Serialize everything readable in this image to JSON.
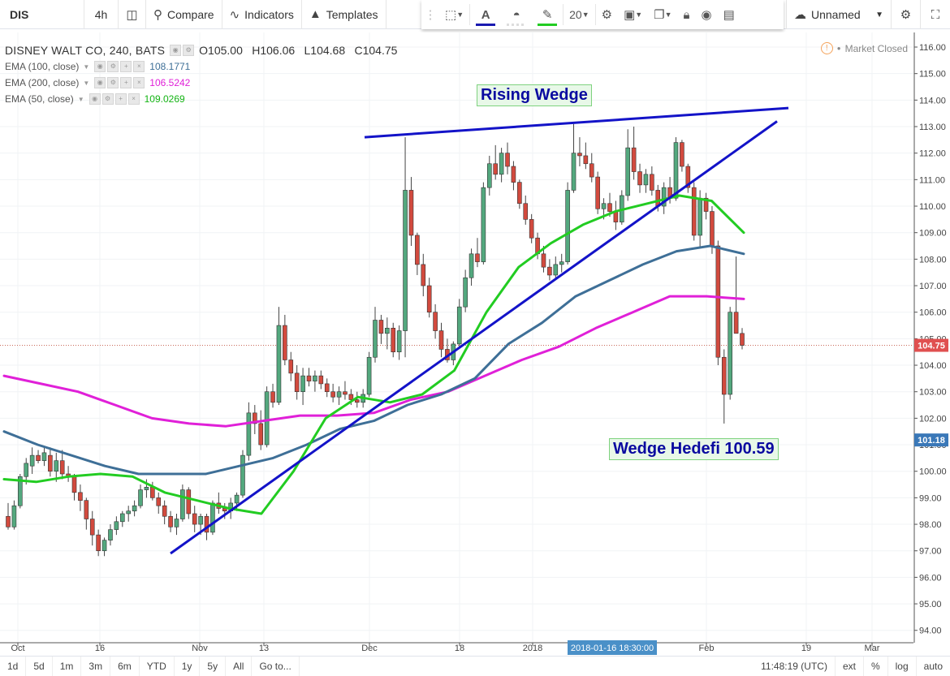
{
  "toolbar": {
    "symbol": "DIS",
    "interval": "4h",
    "compare_label": "Compare",
    "indicators_label": "Indicators",
    "templates_label": "Templates",
    "font_size": "20",
    "layout_name": "Unnamed",
    "icons": [
      "candles-icon",
      "compare-icon",
      "indicators-icon",
      "templates-icon",
      "selection-icon",
      "text-color-icon",
      "fill-icon",
      "pencil-icon",
      "gear-icon",
      "layers-icon",
      "clone-icon",
      "lock-icon",
      "eye-icon",
      "trash-icon",
      "cloud-icon",
      "settings-icon",
      "fullscreen-icon"
    ],
    "accent_text_color": "#1a1ab0",
    "accent_pen_color": "#22cc22"
  },
  "legend": {
    "title": "DISNEY WALT CO, 240, BATS",
    "ohlc": {
      "o": "O105.00",
      "h": "H106.06",
      "l": "L104.68",
      "c": "C104.75"
    },
    "indicators": [
      {
        "name": "EMA (100, close)",
        "value": "108.1771",
        "color": "#3e6f97"
      },
      {
        "name": "EMA (200, close)",
        "value": "106.5242",
        "color": "#e020d8"
      },
      {
        "name": "EMA (50, close)",
        "value": "109.0269",
        "color": "#22cc22"
      }
    ]
  },
  "market_status": "Market Closed",
  "annotations": {
    "rising_wedge": "Rising Wedge",
    "wedge_target": "Wedge Hedefi 100.59"
  },
  "price_axis": {
    "ticks": [
      "116.00",
      "115.00",
      "114.00",
      "113.00",
      "112.00",
      "111.00",
      "110.00",
      "109.00",
      "108.00",
      "107.00",
      "106.00",
      "105.00",
      "104.00",
      "103.00",
      "102.00",
      "101.00",
      "100.00",
      "99.00",
      "98.00",
      "97.00",
      "96.00",
      "95.00",
      "94.00"
    ],
    "last_price": "104.75",
    "last_price_color": "#e05050",
    "target_label": "101.18",
    "target_color": "#3a78b8"
  },
  "time_axis": {
    "ticks": [
      "Oct",
      "16",
      "Nov",
      "13",
      "Dec",
      "18",
      "2018",
      "Feb",
      "19",
      "Mar"
    ],
    "crosshair_label": "2018-01-16 18:30:00"
  },
  "bottom_bar": {
    "ranges": [
      "1d",
      "5d",
      "1m",
      "3m",
      "6m",
      "YTD",
      "1y",
      "5y",
      "All"
    ],
    "goto": "Go to...",
    "time": "11:48:19 (UTC)",
    "options": [
      "ext",
      "%",
      "log",
      "auto"
    ]
  },
  "chart_data": {
    "type": "candlestick",
    "symbol": "DISNEY WALT CO",
    "interval": "240",
    "ylim": [
      93.6,
      116.4
    ],
    "up_color": "#53a87e",
    "down_color": "#d24a3e",
    "candles": [
      [
        98.3,
        98.8,
        97.8,
        97.9
      ],
      [
        97.9,
        98.9,
        97.8,
        98.7
      ],
      [
        98.7,
        99.9,
        98.6,
        99.8
      ],
      [
        99.8,
        100.5,
        99.5,
        100.3
      ],
      [
        100.2,
        100.9,
        99.9,
        100.6
      ],
      [
        100.6,
        100.8,
        100.3,
        100.4
      ],
      [
        100.4,
        100.9,
        100.2,
        100.7
      ],
      [
        100.6,
        100.9,
        99.8,
        100.0
      ],
      [
        100.0,
        100.7,
        99.6,
        100.4
      ],
      [
        100.4,
        100.8,
        99.7,
        99.9
      ],
      [
        99.9,
        100.2,
        99.6,
        99.8
      ],
      [
        99.8,
        99.9,
        98.9,
        99.2
      ],
      [
        99.2,
        99.5,
        98.5,
        98.9
      ],
      [
        98.9,
        99.0,
        97.8,
        98.2
      ],
      [
        98.2,
        98.5,
        97.2,
        97.6
      ],
      [
        97.6,
        97.8,
        96.8,
        97.0
      ],
      [
        97.0,
        97.5,
        96.8,
        97.4
      ],
      [
        97.4,
        98.0,
        97.2,
        97.8
      ],
      [
        97.8,
        98.3,
        97.6,
        98.1
      ],
      [
        98.1,
        98.5,
        97.9,
        98.4
      ],
      [
        98.4,
        98.7,
        98.1,
        98.5
      ],
      [
        98.5,
        98.9,
        98.3,
        98.7
      ],
      [
        98.7,
        99.5,
        98.6,
        99.3
      ],
      [
        99.3,
        99.7,
        99.0,
        99.4
      ],
      [
        99.4,
        99.6,
        98.9,
        99.0
      ],
      [
        99.0,
        99.2,
        98.4,
        98.7
      ],
      [
        98.7,
        98.9,
        98.0,
        98.3
      ],
      [
        98.3,
        98.5,
        97.7,
        97.9
      ],
      [
        97.9,
        98.4,
        97.6,
        98.2
      ],
      [
        98.2,
        99.5,
        98.1,
        99.3
      ],
      [
        99.3,
        99.4,
        98.2,
        98.4
      ],
      [
        98.4,
        98.7,
        97.7,
        98.0
      ],
      [
        98.0,
        98.4,
        97.6,
        98.3
      ],
      [
        98.3,
        98.4,
        97.4,
        97.7
      ],
      [
        97.7,
        98.9,
        97.6,
        98.8
      ],
      [
        98.8,
        99.2,
        98.4,
        98.6
      ],
      [
        98.6,
        98.8,
        98.2,
        98.5
      ],
      [
        98.5,
        99.0,
        98.2,
        98.8
      ],
      [
        98.8,
        99.2,
        98.5,
        99.1
      ],
      [
        99.1,
        100.8,
        99.0,
        100.6
      ],
      [
        100.6,
        102.6,
        100.4,
        102.2
      ],
      [
        102.2,
        102.5,
        101.4,
        101.8
      ],
      [
        101.8,
        102.3,
        100.8,
        101.0
      ],
      [
        101.0,
        103.2,
        100.9,
        103.0
      ],
      [
        103.0,
        103.3,
        102.4,
        102.6
      ],
      [
        102.6,
        106.2,
        102.5,
        105.5
      ],
      [
        105.5,
        105.9,
        104.0,
        104.2
      ],
      [
        104.2,
        104.5,
        103.4,
        103.7
      ],
      [
        103.7,
        104.0,
        102.7,
        103.0
      ],
      [
        103.0,
        103.9,
        102.5,
        103.6
      ],
      [
        103.6,
        103.9,
        103.2,
        103.4
      ],
      [
        103.4,
        103.8,
        103.0,
        103.6
      ],
      [
        103.6,
        103.8,
        103.1,
        103.3
      ],
      [
        103.3,
        103.5,
        102.8,
        103.0
      ],
      [
        103.0,
        103.3,
        102.6,
        102.8
      ],
      [
        102.8,
        103.2,
        102.5,
        103.0
      ],
      [
        103.0,
        103.4,
        102.7,
        102.9
      ],
      [
        102.9,
        103.1,
        102.5,
        102.7
      ],
      [
        102.7,
        103.0,
        102.4,
        102.6
      ],
      [
        102.6,
        103.1,
        102.4,
        102.9
      ],
      [
        102.9,
        104.5,
        102.8,
        104.3
      ],
      [
        104.3,
        106.2,
        104.1,
        105.7
      ],
      [
        105.7,
        105.9,
        104.8,
        105.2
      ],
      [
        105.2,
        105.8,
        104.6,
        105.4
      ],
      [
        105.4,
        105.6,
        104.3,
        104.5
      ],
      [
        104.5,
        105.5,
        104.2,
        105.3
      ],
      [
        105.3,
        112.6,
        104.3,
        110.6
      ],
      [
        110.6,
        111.1,
        108.5,
        108.9
      ],
      [
        108.9,
        109.0,
        107.4,
        107.8
      ],
      [
        107.8,
        108.2,
        106.6,
        107.0
      ],
      [
        107.0,
        107.3,
        105.8,
        106.0
      ],
      [
        106.0,
        106.3,
        105.0,
        105.3
      ],
      [
        105.3,
        105.6,
        104.3,
        104.6
      ],
      [
        104.6,
        105.0,
        104.1,
        104.2
      ],
      [
        104.2,
        104.9,
        104.0,
        104.8
      ],
      [
        104.8,
        106.5,
        104.7,
        106.2
      ],
      [
        106.2,
        107.6,
        106.0,
        107.3
      ],
      [
        107.3,
        108.4,
        107.0,
        108.2
      ],
      [
        108.2,
        108.8,
        107.7,
        107.9
      ],
      [
        107.9,
        110.9,
        107.8,
        110.7
      ],
      [
        110.7,
        111.9,
        110.4,
        111.6
      ],
      [
        111.6,
        112.3,
        111.0,
        111.2
      ],
      [
        111.2,
        112.2,
        110.9,
        112.0
      ],
      [
        112.0,
        112.4,
        111.2,
        111.5
      ],
      [
        111.5,
        111.7,
        110.6,
        110.9
      ],
      [
        110.9,
        111.0,
        109.9,
        110.1
      ],
      [
        110.1,
        110.4,
        109.3,
        109.5
      ],
      [
        109.5,
        109.7,
        108.6,
        108.8
      ],
      [
        108.8,
        109.0,
        108.0,
        108.2
      ],
      [
        108.2,
        108.5,
        107.5,
        107.7
      ],
      [
        107.7,
        108.0,
        107.2,
        107.4
      ],
      [
        107.4,
        108.1,
        107.3,
        107.8
      ],
      [
        107.8,
        108.2,
        107.5,
        107.9
      ],
      [
        107.9,
        110.9,
        107.8,
        110.6
      ],
      [
        110.6,
        113.1,
        110.5,
        112.0
      ],
      [
        112.0,
        112.6,
        111.5,
        111.9
      ],
      [
        111.9,
        112.4,
        111.4,
        111.6
      ],
      [
        111.6,
        112.0,
        110.9,
        111.1
      ],
      [
        111.1,
        111.3,
        109.7,
        109.9
      ],
      [
        109.9,
        110.3,
        109.5,
        110.1
      ],
      [
        110.1,
        110.5,
        109.6,
        109.8
      ],
      [
        109.8,
        110.2,
        109.1,
        109.4
      ],
      [
        109.4,
        110.6,
        109.3,
        110.4
      ],
      [
        110.4,
        112.9,
        110.2,
        112.2
      ],
      [
        112.2,
        113.0,
        111.0,
        111.3
      ],
      [
        111.3,
        111.6,
        110.5,
        110.8
      ],
      [
        110.8,
        111.4,
        110.5,
        111.2
      ],
      [
        111.2,
        111.5,
        110.4,
        110.6
      ],
      [
        110.6,
        110.8,
        109.8,
        110.0
      ],
      [
        110.0,
        110.9,
        109.7,
        110.7
      ],
      [
        110.7,
        111.1,
        110.1,
        110.3
      ],
      [
        110.3,
        112.6,
        110.2,
        112.4
      ],
      [
        112.4,
        112.5,
        111.3,
        111.5
      ],
      [
        111.5,
        111.6,
        110.5,
        110.7
      ],
      [
        110.7,
        110.9,
        108.7,
        108.9
      ],
      [
        108.9,
        110.6,
        108.4,
        110.3
      ],
      [
        110.3,
        110.5,
        109.5,
        109.8
      ],
      [
        109.8,
        110.0,
        108.2,
        108.5
      ],
      [
        108.5,
        108.7,
        104.0,
        104.3
      ],
      [
        104.3,
        104.6,
        101.8,
        102.9
      ],
      [
        102.9,
        106.2,
        102.7,
        106.0
      ],
      [
        106.0,
        108.1,
        105.5,
        105.2
      ],
      [
        105.2,
        105.4,
        104.6,
        104.75
      ]
    ],
    "ema50": [
      99.7,
      99.6,
      99.8,
      99.9,
      99.8,
      99.2,
      98.9,
      98.6,
      98.4,
      100.0,
      102.0,
      102.8,
      102.6,
      102.9,
      103.8,
      106.0,
      107.7,
      108.6,
      109.3,
      109.8,
      110.1,
      110.4,
      110.2,
      109.0
    ],
    "ema100": [
      101.5,
      101.0,
      100.6,
      100.2,
      99.9,
      99.9,
      99.9,
      100.2,
      100.5,
      101.0,
      101.6,
      101.9,
      102.5,
      102.9,
      103.5,
      104.8,
      105.6,
      106.6,
      107.2,
      107.8,
      108.3,
      108.5,
      108.2
    ],
    "ema200": [
      103.6,
      103.3,
      103.0,
      102.5,
      102.0,
      101.8,
      101.7,
      101.9,
      102.1,
      102.1,
      102.2,
      102.7,
      103.0,
      103.6,
      104.2,
      104.7,
      105.4,
      106.0,
      106.6,
      106.6,
      106.5
    ],
    "trendlines": [
      {
        "name": "wedge-upper",
        "from": [
          112.6,
          112.6
        ],
        "to": [
          113.8,
          113.7
        ],
        "color": "#1313c8"
      },
      {
        "name": "wedge-lower",
        "from": [
          96.9,
          96.9
        ],
        "to": [
          113.2,
          113.2
        ],
        "color": "#1313c8"
      }
    ],
    "last_close": 104.75,
    "target": 100.59
  }
}
